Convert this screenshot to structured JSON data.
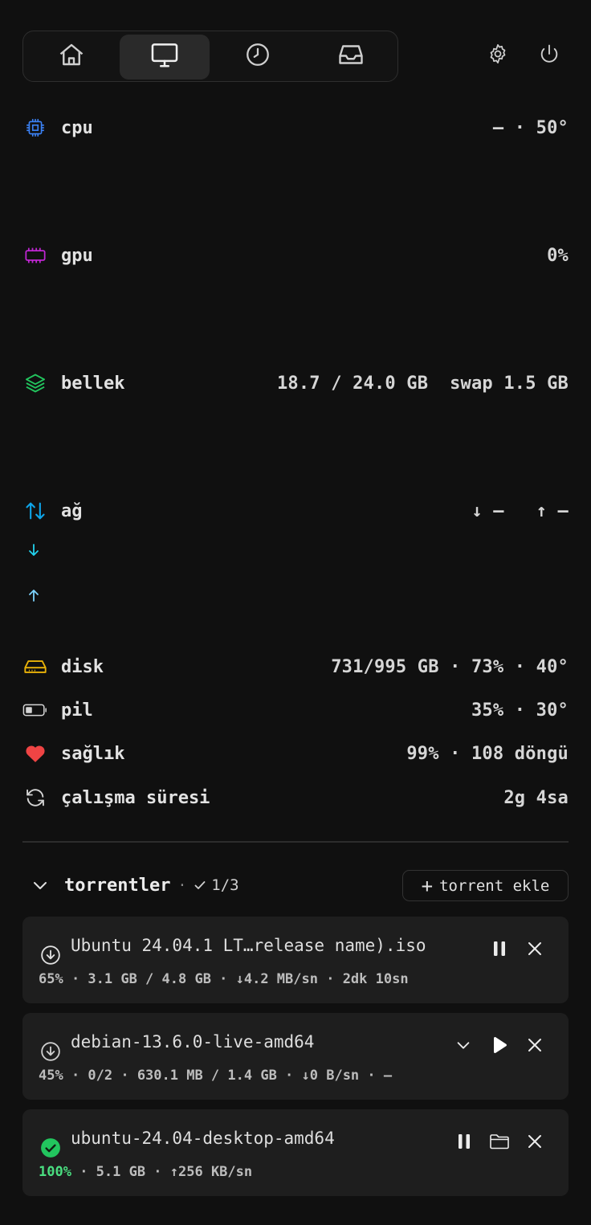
{
  "nav": {
    "tabs": [
      {
        "icon": "home-icon",
        "active": false
      },
      {
        "icon": "monitor-icon",
        "active": true
      },
      {
        "icon": "clock-icon",
        "active": false
      },
      {
        "icon": "inbox-icon",
        "active": false
      }
    ],
    "actions": [
      "gear-icon",
      "power-icon"
    ]
  },
  "metrics": {
    "cpu": {
      "label": "cpu",
      "value": "— · 50°",
      "color": "#3b82f6"
    },
    "gpu": {
      "label": "gpu",
      "value": "0%",
      "color": "#c026d3"
    },
    "memory": {
      "label": "bellek",
      "value": "18.7 / 24.0 GB  swap 1.5 GB",
      "color": "#22c55e"
    },
    "network": {
      "label": "ağ",
      "down": "↓ —",
      "up": "↑ —",
      "color": "#0ea5e9",
      "down_color": "#22d3ee",
      "up_color": "#7dd3fc"
    },
    "disk": {
      "label": "disk",
      "value": "731/995 GB · 73% · 40°",
      "color": "#eab308"
    },
    "battery": {
      "label": "pil",
      "value": "35% · 30°",
      "color": "#d4d4d4"
    },
    "health": {
      "label": "sağlık",
      "value": "99% · 108 döngü",
      "color": "#ef4444"
    },
    "uptime": {
      "label": "çalışma süresi",
      "value": "2g 4sa",
      "color": "#d4d4d4"
    }
  },
  "torrents": {
    "title": "torrentler",
    "count": "1/3",
    "add_label": "torrent ekle",
    "items": [
      {
        "name": "Ubuntu 24.04.1 LT…release name).iso",
        "meta": "65% · 3.1 GB / 4.8 GB · ↓4.2 MB/sn · 2dk 10sn",
        "status": "downloading",
        "pct": "",
        "rest": ""
      },
      {
        "name": "debian-13.6.0-live-amd64",
        "meta": "45% · 0/2 · 630.1 MB / 1.4 GB · ↓0 B/sn · —",
        "status": "paused",
        "pct": "",
        "rest": ""
      },
      {
        "name": "ubuntu-24.04-desktop-amd64",
        "meta": "",
        "status": "complete",
        "pct": "100%",
        "rest": " · 5.1 GB · ↑256 KB/sn"
      }
    ],
    "accent_complete": "#22c55e"
  }
}
